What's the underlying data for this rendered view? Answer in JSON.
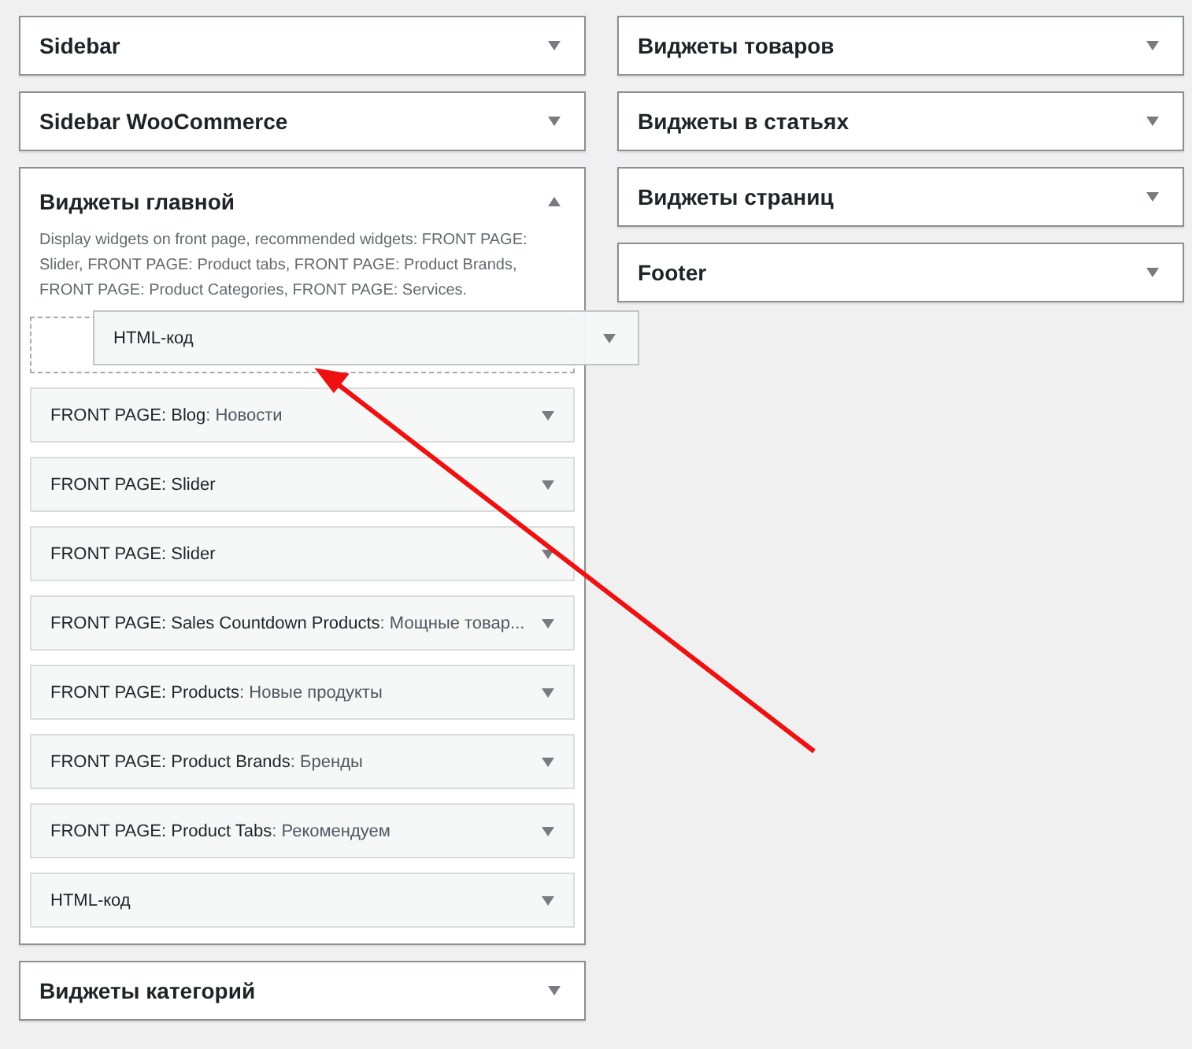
{
  "left_areas": [
    {
      "title": "Sidebar",
      "expanded": false
    },
    {
      "title": "Sidebar WooCommerce",
      "expanded": false
    },
    {
      "title": "Виджеты главной",
      "expanded": true,
      "description": "Display widgets on front page, recommended widgets: FRONT PAGE: Slider, FRONT PAGE: Product tabs, FRONT PAGE: Product Brands, FRONT PAGE: Product Categories, FRONT PAGE: Services.",
      "widgets": [
        {
          "kind": "placeholder"
        },
        {
          "kind": "widget",
          "name": "FRONT PAGE: Blog",
          "in_title": ": Новости"
        },
        {
          "kind": "widget",
          "name": "FRONT PAGE: Slider"
        },
        {
          "kind": "widget",
          "name": "FRONT PAGE: Slider"
        },
        {
          "kind": "widget",
          "name": "FRONT PAGE: Sales Countdown Products",
          "in_title": ": Мощные товар..."
        },
        {
          "kind": "widget",
          "name": "FRONT PAGE: Products",
          "in_title": ": Новые продукты"
        },
        {
          "kind": "widget",
          "name": "FRONT PAGE: Product Brands",
          "in_title": ": Бренды"
        },
        {
          "kind": "widget",
          "name": "FRONT PAGE: Product Tabs",
          "in_title": ": Рекомендуем"
        },
        {
          "kind": "widget",
          "name": "HTML-код"
        }
      ]
    },
    {
      "title": "Виджеты категорий",
      "expanded": false
    }
  ],
  "right_areas": [
    {
      "title": "Виджеты товаров",
      "expanded": false
    },
    {
      "title": "Виджеты в статьях",
      "expanded": false
    },
    {
      "title": "Виджеты страниц",
      "expanded": false
    },
    {
      "title": "Footer",
      "expanded": false
    }
  ],
  "dragged_widget": {
    "name": "HTML-код"
  }
}
